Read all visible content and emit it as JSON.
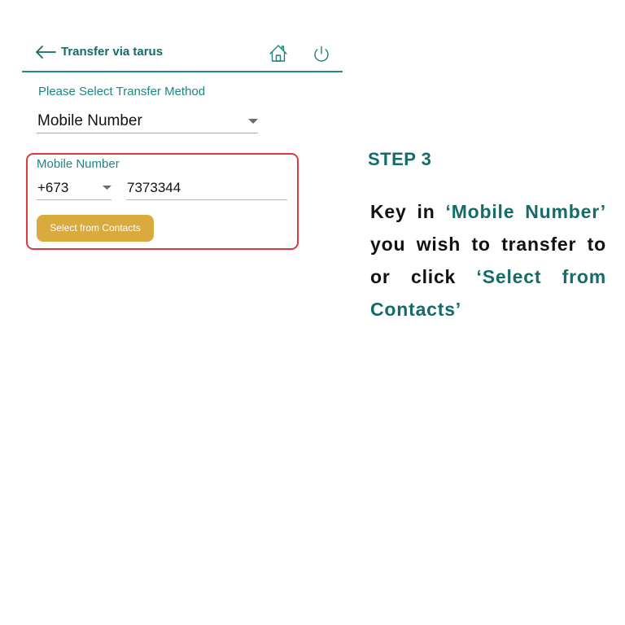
{
  "header": {
    "title": "Transfer via tarus",
    "icons": {
      "back": "arrow-left-icon",
      "home": "home-icon",
      "logout": "power-icon"
    }
  },
  "transfer_method": {
    "label": "Please Select Transfer Method",
    "selected": "Mobile Number",
    "dropdown_icon": "caret-down-icon"
  },
  "mobile_number": {
    "label": "Mobile Number",
    "country_code": "+673",
    "number": "7373344",
    "contacts_button": "Select from Contacts"
  },
  "instruction": {
    "step": "STEP 3",
    "key_in": "Key in",
    "mobile_number_ref": "‘Mobile Number’",
    "transfer_text": "you wish to transfer to",
    "or_click": "or click",
    "select_from_ref": "‘Select from",
    "contacts_ref": "Contacts’"
  },
  "colors": {
    "brand_teal": "#136c69",
    "label_teal": "#1d8682",
    "highlight_red": "#e3373e",
    "button_gold": "#d9aa3d",
    "text_dark": "#111111"
  }
}
